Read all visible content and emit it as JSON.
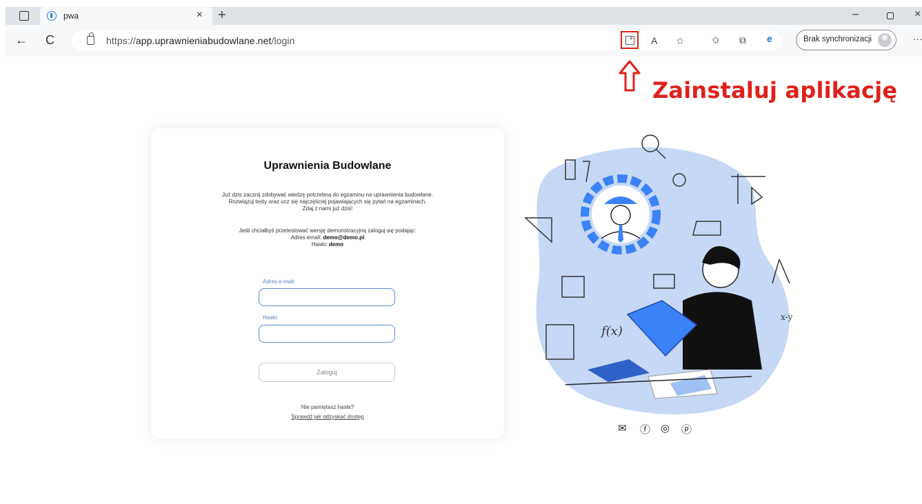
{
  "browser": {
    "tab_title": "pwa",
    "tab_close": "×",
    "new_tab": "+",
    "url_scheme": "https://",
    "url_host": "app.uprawnieniabudowlane.net",
    "url_path": "/login",
    "sync_label": "Brak synchronizacji",
    "window_minimize": "–",
    "window_close": "×",
    "more": "···",
    "back": "←",
    "reload": "C",
    "read_aloud": "A",
    "favorite": "☆",
    "favorites": "✩",
    "collections": "⧉",
    "install_icon": "install-app-icon"
  },
  "annotation": {
    "text": "Zainstaluj aplikację",
    "color": "#e0201c"
  },
  "login": {
    "title": "Uprawnienia Budowlane",
    "intro_line1": "Już dzis zacznij zdobywać wiedzę potrzebną do egzaminu na uprawnienia budowlane.",
    "intro_line2": "Rozwiązuj testy oraz ucz się najczęściej pojawiających się pytań na egzaminach.",
    "intro_line3": "Zdaj z nami już dziś!",
    "demo_line": "Jeśli chciałbyś przetestować wersję demonstracyjną zaloguj się podając:",
    "email_prefix": "Adres email:",
    "email_value": "demo@demo.pl",
    "password_prefix": "Hasło:",
    "password_value": "demo",
    "email_label": "Adres e-mail:",
    "password_label": "Hasło:",
    "submit_label": "Zaloguj",
    "forgot_text": "Nie pamiętasz hasła?",
    "recover_link": "Sprawdź jak odzyskać dostęp"
  },
  "social": {
    "icons": [
      "mail-icon",
      "facebook-icon",
      "instagram-icon",
      "pinterest-icon"
    ],
    "glyphs": [
      "✉",
      "ⓕ",
      "◎",
      "ⓟ"
    ]
  },
  "colors": {
    "accent": "#5b88d6",
    "blob": "#c6d8f5",
    "gear": "#3b82f6"
  }
}
